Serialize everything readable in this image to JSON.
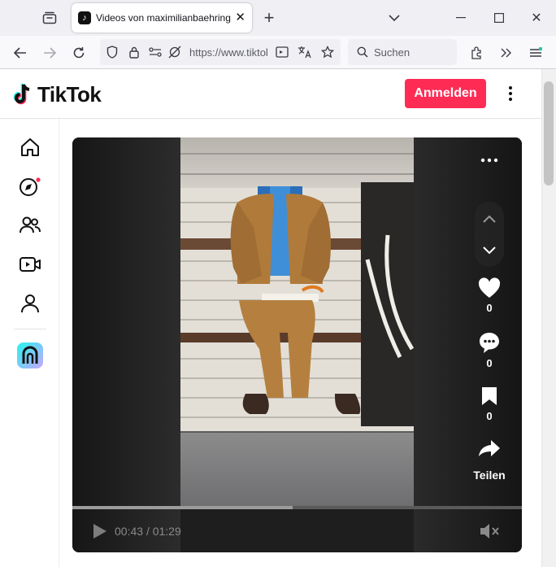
{
  "browser": {
    "tab_title": "Videos von maximilianbaehring",
    "url": "https://www.tiktok.com",
    "search_placeholder": "Suchen"
  },
  "header": {
    "logo_text": "TikTok",
    "login_label": "Anmelden"
  },
  "sidebar": {
    "items": [
      "home-icon",
      "explore-icon",
      "following-icon",
      "live-icon",
      "profile-icon"
    ]
  },
  "video": {
    "time_current": "00:43",
    "time_total": "01:29",
    "progress_fraction": 0.49,
    "likes": "0",
    "comments": "0",
    "saves": "0",
    "share_label": "Teilen"
  },
  "colors": {
    "brand": "#fe2c55",
    "accent_cyan": "#25f4ee"
  }
}
